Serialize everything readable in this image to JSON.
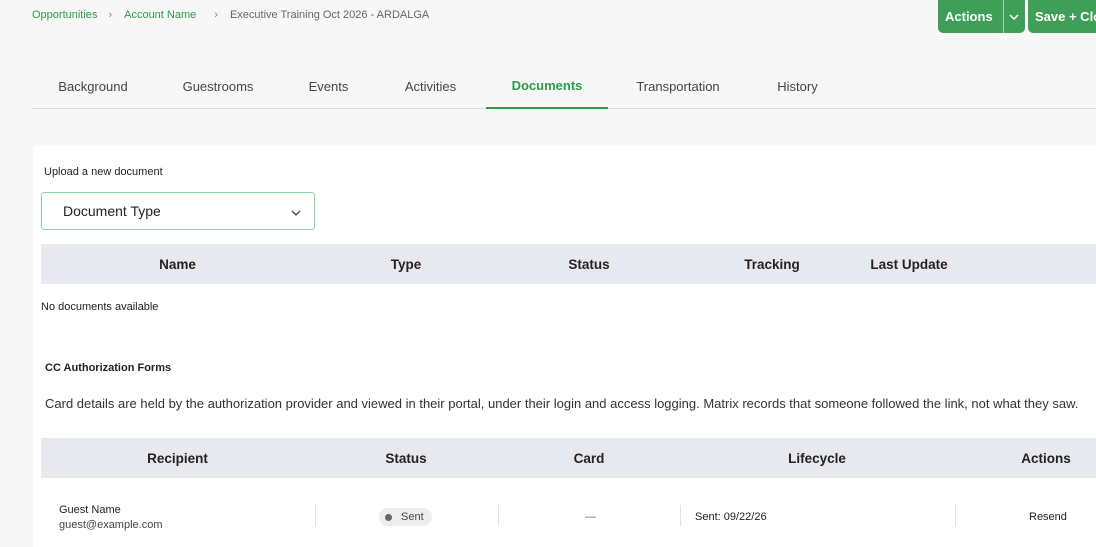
{
  "breadcrumb": {
    "items": [
      "Opportunities",
      "Account Name"
    ],
    "current": "Executive Training Oct 2026 - ARDALGA"
  },
  "header": {
    "actions_label": "Actions",
    "save_label": "Save + Close"
  },
  "tabs": [
    {
      "label": "Background"
    },
    {
      "label": "Guestrooms"
    },
    {
      "label": "Events"
    },
    {
      "label": "Activities"
    },
    {
      "label": "Documents"
    },
    {
      "label": "Transportation"
    },
    {
      "label": "History"
    }
  ],
  "active_tab": "Documents",
  "upload": {
    "label": "Upload a new document",
    "select_value": "Document Type"
  },
  "documents": {
    "columns": [
      "Name",
      "Type",
      "Status",
      "Tracking",
      "Last Update"
    ],
    "empty_text": "No documents available"
  },
  "cc_forms": {
    "title": "CC Authorization Forms",
    "description": "Card details are held by the authorization provider and viewed in their portal, under their login and access logging. Matrix records that someone followed the link, not what they saw.",
    "columns": [
      "Recipient",
      "Status",
      "Card",
      "Lifecycle",
      "Actions"
    ],
    "rows": [
      {
        "name": "Guest Name",
        "email": "guest@example.com",
        "status": "Sent",
        "card": "—",
        "lifecycle": "Sent: 09/22/26",
        "action": "Resend"
      }
    ]
  },
  "colors": {
    "accent": "#2e9a4a",
    "button": "#3f9e58",
    "header_bg": "#e7e9ee"
  }
}
